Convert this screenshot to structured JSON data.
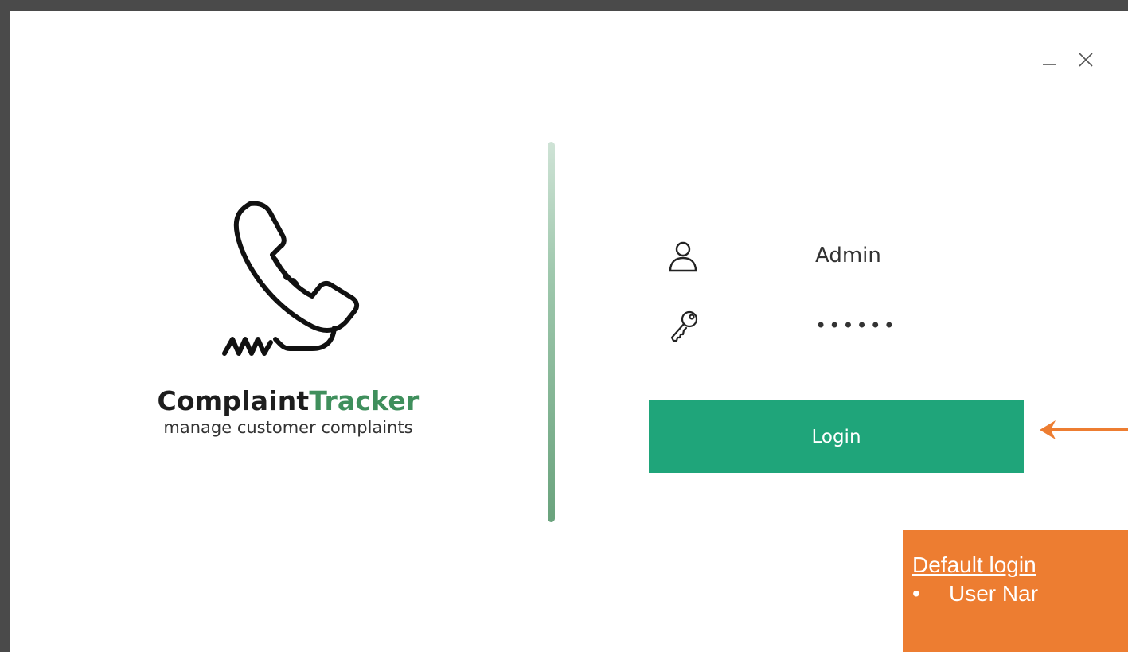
{
  "window": {
    "minimize_label": "_",
    "close_label": "×"
  },
  "brand": {
    "name_part1": "Complaint",
    "name_part2": "Tracker",
    "tagline": "manage customer complaints",
    "logo_icon": "phone-handset-icon",
    "accent_color": "#3f8f5c"
  },
  "login_form": {
    "username_icon": "user-icon",
    "username_value": "Admin",
    "password_icon": "key-icon",
    "password_value": "••••••",
    "login_label": "Login",
    "button_color": "#1fa57a"
  },
  "annotation": {
    "title": "Default login",
    "items": [
      "User Nar"
    ],
    "bullet": "•",
    "color": "#ed7d31",
    "arrow_icon": "arrow-left-icon"
  }
}
